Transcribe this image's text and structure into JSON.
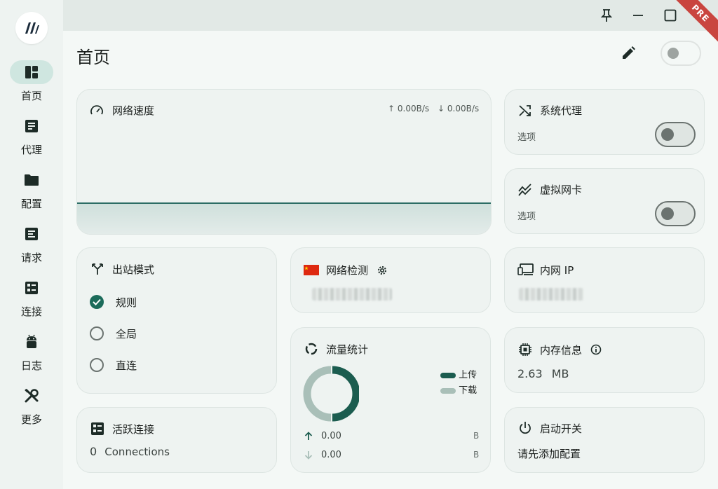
{
  "window": {
    "ribbon": "PRE"
  },
  "sidebar": {
    "items": [
      {
        "label": "首页",
        "icon": "dashboard-icon",
        "active": true
      },
      {
        "label": "代理",
        "icon": "list-icon"
      },
      {
        "label": "配置",
        "icon": "folder-icon"
      },
      {
        "label": "请求",
        "icon": "request-icon"
      },
      {
        "label": "连接",
        "icon": "connections-icon"
      },
      {
        "label": "日志",
        "icon": "android-icon"
      },
      {
        "label": "更多",
        "icon": "tools-icon"
      }
    ]
  },
  "header": {
    "title": "首页"
  },
  "speed": {
    "title": "网络速度",
    "up": "↑ 0.00B/s",
    "down": "↓ 0.00B/s"
  },
  "system_proxy": {
    "title": "系统代理",
    "sub": "选项"
  },
  "tun": {
    "title": "虚拟网卡",
    "sub": "选项"
  },
  "outbound": {
    "title": "出站模式",
    "options": [
      {
        "label": "规则",
        "checked": true
      },
      {
        "label": "全局"
      },
      {
        "label": "直连"
      }
    ]
  },
  "network_check": {
    "title": "网络检测"
  },
  "intranet_ip": {
    "title": "内网 IP"
  },
  "traffic": {
    "title": "流量统计",
    "legend_up": "上传",
    "legend_down": "下载",
    "up_value": "0.00",
    "up_unit": "B",
    "down_value": "0.00",
    "down_unit": "B",
    "colors": {
      "up": "#1b5c4f",
      "down": "#a9bfb8"
    }
  },
  "memory": {
    "title": "内存信息",
    "value": "2.63",
    "unit": "MB"
  },
  "active_connections": {
    "title": "活跃连接",
    "count": "0",
    "label": "Connections"
  },
  "startup": {
    "title": "启动开关",
    "hint": "请先添加配置"
  }
}
